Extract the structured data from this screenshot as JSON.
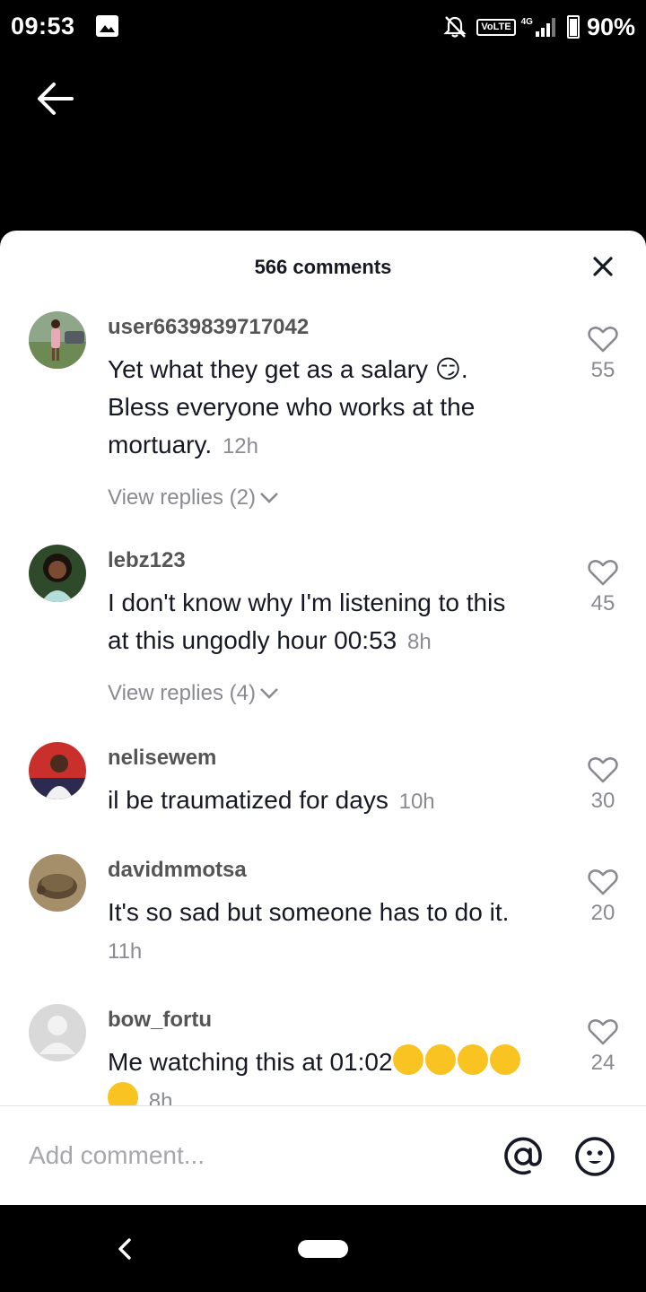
{
  "status_bar": {
    "time": "09:53",
    "volte": "VoLTE",
    "network": "4G",
    "battery": "90%"
  },
  "sheet": {
    "title": "566 comments"
  },
  "comments": [
    {
      "username": "user6639839717042",
      "text_lines": [
        "Yet what they get as a salary 😏.",
        "Bless everyone who works at the",
        "mortuary."
      ],
      "time": "12h",
      "likes": "55",
      "view_replies": "View replies (2)"
    },
    {
      "username": "lebz123",
      "text_lines": [
        "I don't know why I'm listening to this",
        "at this ungodly hour 00:53"
      ],
      "time": "8h",
      "likes": "45",
      "view_replies": "View replies (4)"
    },
    {
      "username": "nelisewem",
      "text_lines": [
        "il be traumatized for days"
      ],
      "time": "10h",
      "likes": "30"
    },
    {
      "username": "davidmmotsa",
      "text_lines": [
        "It's so sad but someone has to do it."
      ],
      "time": "11h",
      "likes": "20"
    },
    {
      "username": "bow_fortu",
      "text_lines": [
        "Me watching this at 01:02"
      ],
      "time": "8h",
      "likes": "24"
    }
  ],
  "input": {
    "placeholder": "Add comment..."
  },
  "colors": {
    "text": "#161823",
    "muted": "#8a8b91",
    "background": "#ffffff"
  }
}
